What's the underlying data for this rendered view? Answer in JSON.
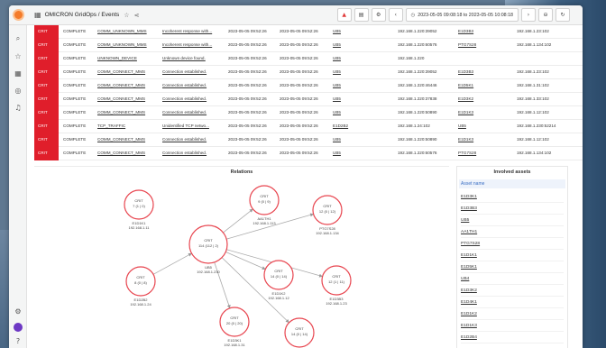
{
  "header": {
    "breadcrumb": "OMICRON GridOps / Events",
    "time_range": "2023-05-05 09:08:18 to 2023-05-05 10:08:18",
    "buttons": {
      "add_panel": "⊕",
      "save": "▤",
      "settings": "⚙",
      "zoom_out": "⊖",
      "refresh": "↻"
    },
    "chart_button": "▲"
  },
  "sidebar": {
    "icons": [
      "search-icon",
      "star-icon",
      "dashboards-icon",
      "explore-icon",
      "alerting-icon",
      "settings-icon",
      "avatar",
      "help-icon"
    ]
  },
  "events": [
    {
      "severity": "CRIT",
      "status": "COMPLETE",
      "type": "COMM_UNKNOWN_MMS",
      "message": "Incoherent response with...",
      "t1": "2023-05-05 09:52:26",
      "t2": "2023-05-05 09:52:26",
      "device": "UB5",
      "src": "192.168.1.220:39052",
      "ied": "E1D3B3",
      "dst": "192.168.1.23:102"
    },
    {
      "severity": "CRIT",
      "status": "COMPLETE",
      "type": "COMM_UNKNOWN_MMS",
      "message": "Incoherent response with...",
      "t1": "2023-05-05 09:52:26",
      "t2": "2023-05-05 09:52:26",
      "device": "UB5",
      "src": "192.168.1.220:60576",
      "ied": "PTG7S28",
      "dst": "192.168.1.134:102"
    },
    {
      "severity": "CRIT",
      "status": "COMPLETE",
      "type": "UNKNOWN_DEVICE",
      "message": "Unknown device found.",
      "t1": "2023-05-05 09:52:26",
      "t2": "2023-05-05 09:52:26",
      "device": "UB5",
      "src": "192.168.1.220",
      "ied": "",
      "dst": ""
    },
    {
      "severity": "CRIT",
      "status": "COMPLETE",
      "type": "COMM_CONNECT_MMS",
      "message": "Connection established.",
      "t1": "2023-05-05 09:52:26",
      "t2": "2023-05-05 09:52:26",
      "device": "UB5",
      "src": "192.168.1.220:39052",
      "ied": "E1D3B3",
      "dst": "192.168.1.23:102"
    },
    {
      "severity": "CRIT",
      "status": "COMPLETE",
      "type": "COMM_CONNECT_MMS",
      "message": "Connection established.",
      "t1": "2023-05-05 09:52:26",
      "t2": "2023-05-05 09:52:26",
      "device": "UB5",
      "src": "192.168.1.220:46446",
      "ied": "E1D5K1",
      "dst": "192.168.1.31:102"
    },
    {
      "severity": "CRIT",
      "status": "COMPLETE",
      "type": "COMM_CONNECT_MMS",
      "message": "Connection established.",
      "t1": "2023-05-05 09:52:26",
      "t2": "2023-05-05 09:52:26",
      "device": "UB5",
      "src": "192.168.1.220:37838",
      "ied": "E1D3K2",
      "dst": "192.168.1.33:102"
    },
    {
      "severity": "CRIT",
      "status": "COMPLETE",
      "type": "COMM_CONNECT_MMS",
      "message": "Connection established.",
      "t1": "2023-05-05 09:52:26",
      "t2": "2023-05-05 09:52:26",
      "device": "UB5",
      "src": "192.168.1.220:50890",
      "ied": "E1D1K3",
      "dst": "192.168.1.12:102"
    },
    {
      "severity": "CRIT",
      "status": "COMPLETE",
      "type": "TCP_TRAFFIC",
      "message": "Unidentified TCP netwo...",
      "t1": "2023-05-05 09:52:26",
      "t2": "2023-05-05 09:52:26",
      "device": "E1D2B2",
      "src": "192.168.1.24:102",
      "ied": "UB5",
      "dst": "192.168.1.230:52214"
    },
    {
      "severity": "CRIT",
      "status": "COMPLETE",
      "type": "COMM_CONNECT_MMS",
      "message": "Connection established.",
      "t1": "2023-05-05 09:52:26",
      "t2": "2023-05-05 09:52:26",
      "device": "UB5",
      "src": "192.168.1.220:50890",
      "ied": "E1D1K3",
      "dst": "192.168.1.12:102"
    },
    {
      "severity": "CRIT",
      "status": "COMPLETE",
      "type": "COMM_CONNECT_MMS",
      "message": "Connection established.",
      "t1": "2023-05-05 09:52:26",
      "t2": "2023-05-05 09:52:26",
      "device": "UB5",
      "src": "192.168.1.220:60576",
      "ied": "PTG7S28",
      "dst": "192.168.1.134:102"
    }
  ],
  "relations": {
    "title": "Relations",
    "nodes": [
      {
        "id": "n1",
        "line1": "CRIT",
        "line2": "7 (1 | 0)",
        "name": "E1D1K1",
        "ip": "192.168.1.11"
      },
      {
        "id": "n2",
        "line1": "CRIT",
        "line2": "9 (0 | 9)",
        "name": "AA1TH1",
        "ip": "192.168.1.113"
      },
      {
        "id": "n3",
        "line1": "CRIT",
        "line2": "12 (0 | 12)",
        "name": "PTG7S28",
        "ip": "192.168.1.134"
      },
      {
        "id": "n4",
        "line1": "CRIT",
        "line2": "114 (112 | 2)",
        "name": "UB5",
        "ip": "192.168.1.230"
      },
      {
        "id": "n5",
        "line1": "CRIT",
        "line2": "8 (0 | 8)",
        "name": "E1D2B2",
        "ip": "192.168.1.24"
      },
      {
        "id": "n6",
        "line1": "CRIT",
        "line2": "14 (0 | 14)",
        "name": "E1D1K2",
        "ip": "192.168.1.12"
      },
      {
        "id": "n7",
        "line1": "CRIT",
        "line2": "12 (1 | 11)",
        "name": "E1D3B3",
        "ip": "192.168.1.23"
      },
      {
        "id": "n8",
        "line1": "CRIT",
        "line2": "20 (0 | 20)",
        "name": "E1D3K1",
        "ip": "192.168.1.31"
      },
      {
        "id": "n9",
        "line1": "CRIT",
        "line2": "14 (0 | 14)",
        "name": "E1D3K2",
        "ip": "192.168.1.33"
      }
    ]
  },
  "assets": {
    "title": "Involved assets",
    "column": "Asset name",
    "items": [
      "E1D3K1",
      "E1D3B3",
      "UB5",
      "AA1TH1",
      "PTG7S28",
      "E1D1K1",
      "E1D5K1",
      "UB4",
      "E1D3K2",
      "E1D4K1",
      "E1D1K2",
      "E1D1K3",
      "E1D2B4"
    ]
  },
  "colors": {
    "critical": "#e01e2b",
    "node_stroke": "#e8454f",
    "accent": "#3a6fc4"
  }
}
